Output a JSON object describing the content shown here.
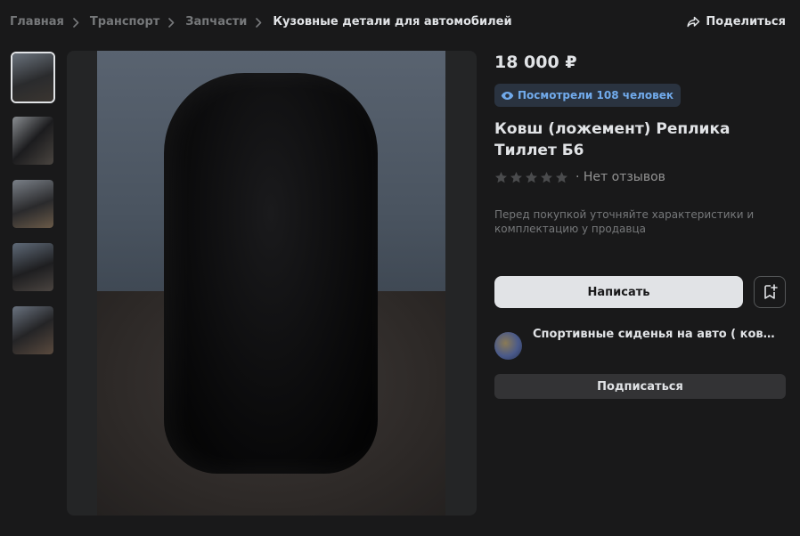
{
  "breadcrumbs": [
    {
      "label": "Главная"
    },
    {
      "label": "Транспорт"
    },
    {
      "label": "Запчасти"
    },
    {
      "label": "Кузовные детали для автомобилей"
    }
  ],
  "share": {
    "label": "Поделиться",
    "icon": "share-arrow-icon"
  },
  "gallery": {
    "thumbnails_count": 5,
    "active_index": 0
  },
  "product": {
    "price": "18 000 ₽",
    "views_label": "Посмотрели 108 человек",
    "title": "Ковш (ложемент) Реплика Тиллет Б6",
    "rating_stars": 0,
    "rating_max": 5,
    "reviews_label": "· Нет отзывов",
    "note": "Перед покупкой уточняйте характеристики и комплектацию у продавца"
  },
  "actions": {
    "write_label": "Написать",
    "save_icon": "bookmark-add-icon",
    "subscribe_label": "Подписаться"
  },
  "seller": {
    "name": "Спортивные сиденья на авто ( ковши/ложементы)"
  },
  "colors": {
    "accent": "#71aaeb",
    "background": "#19191a",
    "primary_button": "#e1e3e6"
  }
}
